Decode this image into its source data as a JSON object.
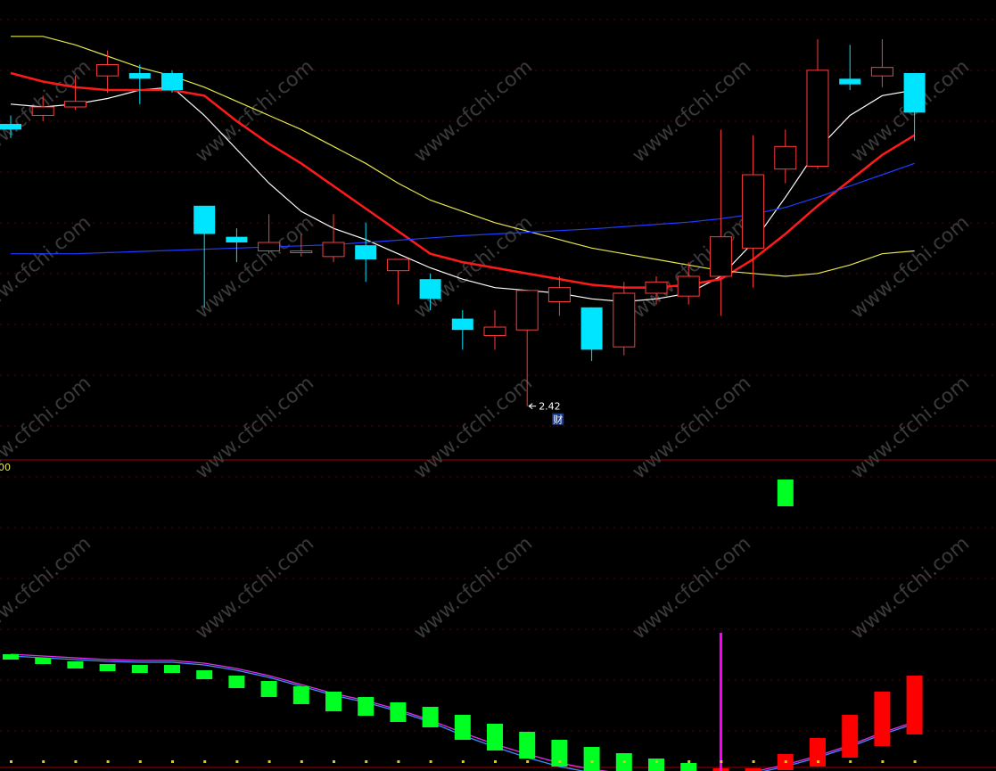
{
  "chart_data": [
    {
      "type": "candlestick",
      "panel": "price",
      "grid": true,
      "annotations": {
        "low_marker": "2.42",
        "finance_badge": "财"
      },
      "colors": {
        "up": "#ff3b3b",
        "down": "#00e5ff",
        "ma_white": "#ffffff",
        "ma_red": "#ff1a1a",
        "ma_yellow": "#e6e64d",
        "ma_blue": "#1f3cff",
        "grid": "#5a0000",
        "axis_line": "#a00000"
      },
      "candles": [
        {
          "o": 2.92,
          "h": 2.935,
          "l": 2.895,
          "c": 2.91
        },
        {
          "o": 2.935,
          "h": 2.97,
          "l": 2.925,
          "c": 2.95
        },
        {
          "o": 2.95,
          "h": 3.005,
          "l": 2.945,
          "c": 2.96
        },
        {
          "o": 3.005,
          "h": 3.05,
          "l": 2.975,
          "c": 3.025
        },
        {
          "o": 3.01,
          "h": 3.025,
          "l": 2.955,
          "c": 3.0
        },
        {
          "o": 3.01,
          "h": 3.015,
          "l": 2.975,
          "c": 2.98
        },
        {
          "o": 2.775,
          "h": 2.775,
          "l": 2.595,
          "c": 2.725
        },
        {
          "o": 2.72,
          "h": 2.735,
          "l": 2.675,
          "c": 2.71
        },
        {
          "o": 2.695,
          "h": 2.76,
          "l": 2.69,
          "c": 2.71
        },
        {
          "o": 2.695,
          "h": 2.725,
          "l": 2.685,
          "c": 2.695
        },
        {
          "o": 2.685,
          "h": 2.76,
          "l": 2.675,
          "c": 2.71
        },
        {
          "o": 2.705,
          "h": 2.745,
          "l": 2.64,
          "c": 2.68
        },
        {
          "o": 2.66,
          "h": 2.67,
          "l": 2.6,
          "c": 2.68
        },
        {
          "o": 2.645,
          "h": 2.655,
          "l": 2.59,
          "c": 2.61
        },
        {
          "o": 2.575,
          "h": 2.59,
          "l": 2.52,
          "c": 2.555
        },
        {
          "o": 2.545,
          "h": 2.59,
          "l": 2.52,
          "c": 2.56
        },
        {
          "o": 2.555,
          "h": 2.595,
          "l": 2.42,
          "c": 2.625
        },
        {
          "o": 2.605,
          "h": 2.65,
          "l": 2.58,
          "c": 2.63
        },
        {
          "o": 2.595,
          "h": 2.595,
          "l": 2.5,
          "c": 2.52
        },
        {
          "o": 2.525,
          "h": 2.64,
          "l": 2.51,
          "c": 2.62
        },
        {
          "o": 2.62,
          "h": 2.65,
          "l": 2.6,
          "c": 2.64
        },
        {
          "o": 2.615,
          "h": 2.675,
          "l": 2.6,
          "c": 2.65
        },
        {
          "o": 2.65,
          "h": 2.91,
          "l": 2.58,
          "c": 2.72
        },
        {
          "o": 2.7,
          "h": 2.9,
          "l": 2.63,
          "c": 2.83
        },
        {
          "o": 2.84,
          "h": 2.91,
          "l": 2.815,
          "c": 2.88
        },
        {
          "o": 2.845,
          "h": 3.07,
          "l": 2.84,
          "c": 3.015
        },
        {
          "o": 3.0,
          "h": 3.06,
          "l": 2.98,
          "c": 2.99
        },
        {
          "o": 3.005,
          "h": 3.07,
          "l": 2.985,
          "c": 3.02
        },
        {
          "o": 3.01,
          "h": 3.01,
          "l": 2.89,
          "c": 2.94
        }
      ],
      "ma": [
        {
          "color": "white",
          "values": [
            2.955,
            2.95,
            2.955,
            2.965,
            2.98,
            2.985,
            2.935,
            2.875,
            2.815,
            2.765,
            2.735,
            2.715,
            2.69,
            2.665,
            2.645,
            2.63,
            2.625,
            2.62,
            2.61,
            2.605,
            2.61,
            2.62,
            2.65,
            2.71,
            2.79,
            2.875,
            2.935,
            2.97,
            2.98
          ]
        },
        {
          "color": "red",
          "values": [
            3.01,
            2.995,
            2.985,
            2.98,
            2.98,
            2.98,
            2.97,
            2.925,
            2.885,
            2.85,
            2.81,
            2.77,
            2.73,
            2.69,
            2.675,
            2.665,
            2.655,
            2.645,
            2.635,
            2.63,
            2.63,
            2.635,
            2.645,
            2.68,
            2.725,
            2.775,
            2.82,
            2.865,
            2.9
          ]
        },
        {
          "color": "yellow",
          "values": [
            3.075,
            3.075,
            3.06,
            3.04,
            3.02,
            3.005,
            2.985,
            2.96,
            2.935,
            2.91,
            2.88,
            2.85,
            2.815,
            2.785,
            2.765,
            2.745,
            2.73,
            2.715,
            2.7,
            2.69,
            2.68,
            2.67,
            2.66,
            2.655,
            2.65,
            2.655,
            2.67,
            2.69,
            2.695
          ]
        },
        {
          "color": "blue",
          "values": [
            2.69,
            2.69,
            2.69,
            2.692,
            2.694,
            2.696,
            2.698,
            2.7,
            2.702,
            2.704,
            2.706,
            2.71,
            2.714,
            2.718,
            2.722,
            2.725,
            2.728,
            2.731,
            2.734,
            2.738,
            2.742,
            2.746,
            2.752,
            2.76,
            2.772,
            2.79,
            2.81,
            2.83,
            2.85
          ]
        }
      ]
    },
    {
      "type": "bar",
      "panel": "indicator",
      "axis_label": "00",
      "colors": {
        "up": "#ff0000",
        "down": "#00ff22",
        "line_magenta": "#e52fe5",
        "line_blue": "#3b8cff",
        "signal": "#ff00ff",
        "dot": "#e6c800"
      },
      "values": [
        0.4,
        0.35,
        0.3,
        0.27,
        0.25,
        0.25,
        0.18,
        0.08,
        -0.02,
        -0.1,
        -0.18,
        -0.23,
        -0.3,
        -0.36,
        -0.5,
        -0.62,
        -0.71,
        -0.8,
        -0.88,
        -0.93,
        -0.95,
        -0.96,
        -0.91,
        -0.82,
        -0.66,
        -0.48,
        -0.22,
        0.04,
        0.22
      ],
      "bar_base": [
        0.46,
        0.42,
        0.38,
        0.35,
        0.34,
        0.34,
        0.28,
        0.22,
        0.16,
        0.1,
        0.04,
        -0.02,
        -0.08,
        -0.13,
        -0.22,
        -0.32,
        -0.41,
        -0.5,
        -0.58,
        -0.65,
        -0.71,
        -0.76,
        -0.82,
        -0.84,
        -0.84,
        -0.8,
        -0.7,
        -0.57,
        -0.44
      ],
      "line_magenta": [
        0.46,
        0.44,
        0.42,
        0.4,
        0.39,
        0.39,
        0.36,
        0.3,
        0.22,
        0.12,
        0.02,
        -0.06,
        -0.16,
        -0.28,
        -0.42,
        -0.55,
        -0.66,
        -0.76,
        -0.83,
        -0.88,
        -0.92,
        -0.93,
        -0.91,
        -0.86,
        -0.78,
        -0.68,
        -0.56,
        -0.42,
        -0.3
      ],
      "line_blue": [
        0.44,
        0.42,
        0.4,
        0.38,
        0.37,
        0.37,
        0.34,
        0.28,
        0.2,
        0.1,
        0.0,
        -0.08,
        -0.18,
        -0.3,
        -0.45,
        -0.58,
        -0.7,
        -0.8,
        -0.87,
        -0.92,
        -0.95,
        -0.96,
        -0.93,
        -0.88,
        -0.8,
        -0.7,
        -0.58,
        -0.44,
        -0.32
      ],
      "signal_index": 22,
      "indicator_top_bar": {
        "index": 24,
        "value": 1.0
      }
    }
  ],
  "watermark": "www.cfchi.com"
}
